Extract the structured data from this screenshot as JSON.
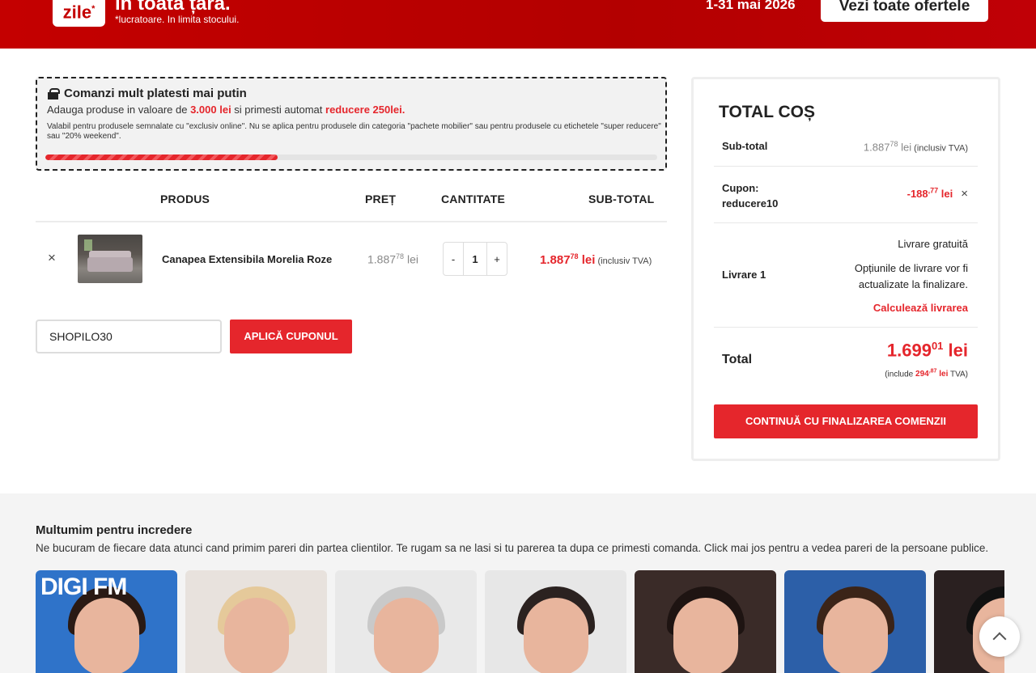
{
  "banner": {
    "logo": "zile",
    "logo_star": "*",
    "headline": "în toată țara.",
    "note": "*lucratoare. In limita stocului.",
    "dates": "1-31 mai 2026",
    "cta": "Vezi toate ofertele"
  },
  "promo": {
    "title": "Comanzi mult platesti mai putin",
    "line_prefix": "Adauga produse in valoare de ",
    "amount": "3.000 lei",
    "line_middle": " si primesti automat ",
    "discount": "reducere 250lei.",
    "fine_print": "Valabil pentru produsele semnalate cu \"exclusiv online\". Nu se aplica pentru produsele din categoria \"pachete mobilier\" sau pentru produsele cu etichetele \"super reducere\" sau \"20% weekend\".",
    "progress": 0.38
  },
  "cart_table": {
    "headers": {
      "product": "PRODUS",
      "price": "PREȚ",
      "quantity": "CANTITATE",
      "subtotal": "SUB-TOTAL"
    },
    "rows": [
      {
        "remove": "×",
        "name": "Canapea Extensibila Morelia Roze",
        "price_int": "1.887",
        "price_dec": "78",
        "currency": " lei",
        "qty_minus": "-",
        "qty": "1",
        "qty_plus": "+",
        "subtotal_int": "1.887",
        "subtotal_dec": "78",
        "subtotal_currency": " lei",
        "subtotal_note": " (inclusiv TVA)"
      }
    ]
  },
  "coupon": {
    "value": "SHOPILO30",
    "apply": "APLICĂ CUPONUL"
  },
  "totals": {
    "title": "TOTAL COȘ",
    "subtotal_label": "Sub-total",
    "subtotal_int": "1.887",
    "subtotal_dec": "78",
    "subtotal_currency": " lei",
    "subtotal_note": " (inclusiv TVA)",
    "coupon_label_1": "Cupon:",
    "coupon_label_2": "reducere10",
    "coupon_int": "-188",
    "coupon_dec": ",77",
    "coupon_currency": " lei",
    "coupon_remove": "×",
    "shipping_label": "Livrare 1",
    "shipping_free": "Livrare gratuită",
    "shipping_info_1": "Opțiunile de livrare vor fi",
    "shipping_info_2": "actualizate la finalizare.",
    "shipping_calc": "Calculează livrarea",
    "total_label": "Total",
    "total_int": "1.699",
    "total_dec": "01",
    "total_currency": " lei",
    "tva_prefix": "(include ",
    "tva_int": "294",
    "tva_dec": ",87",
    "tva_currency": " lei",
    "tva_suffix": " TVA)",
    "checkout": "CONTINUĂ CU FINALIZAREA COMENZII"
  },
  "testimonials": {
    "title": "Multumim pentru incredere",
    "description": "Ne bucuram de fiecare data atunci cand primim pareri din partea clientilor. Te rugam sa ne lasi si tu parerea ta dupa ce primesti comanda. Click mai jos pentru a vedea pareri de la persoane publice.",
    "first_card_text": "DIGI FM",
    "cards": [
      {
        "bg": "#2f73c9",
        "hair": "#2a1a14"
      },
      {
        "bg": "#e8e2dd",
        "hair": "#e5c99a"
      },
      {
        "bg": "#e9e9e9",
        "hair": "#c9c9c9"
      },
      {
        "bg": "#e7e7e7",
        "hair": "#2b2220"
      },
      {
        "bg": "#3a2b28",
        "hair": "#1e1412"
      },
      {
        "bg": "#2c5fa8",
        "hair": "#3b2418"
      },
      {
        "bg": "#2a2020",
        "hair": "#111111"
      }
    ]
  },
  "colors": {
    "accent": "#e5262c",
    "banner": "#c40000"
  },
  "icons": {
    "gift": "gift-icon",
    "scroll_top": "chevron-up-icon"
  }
}
